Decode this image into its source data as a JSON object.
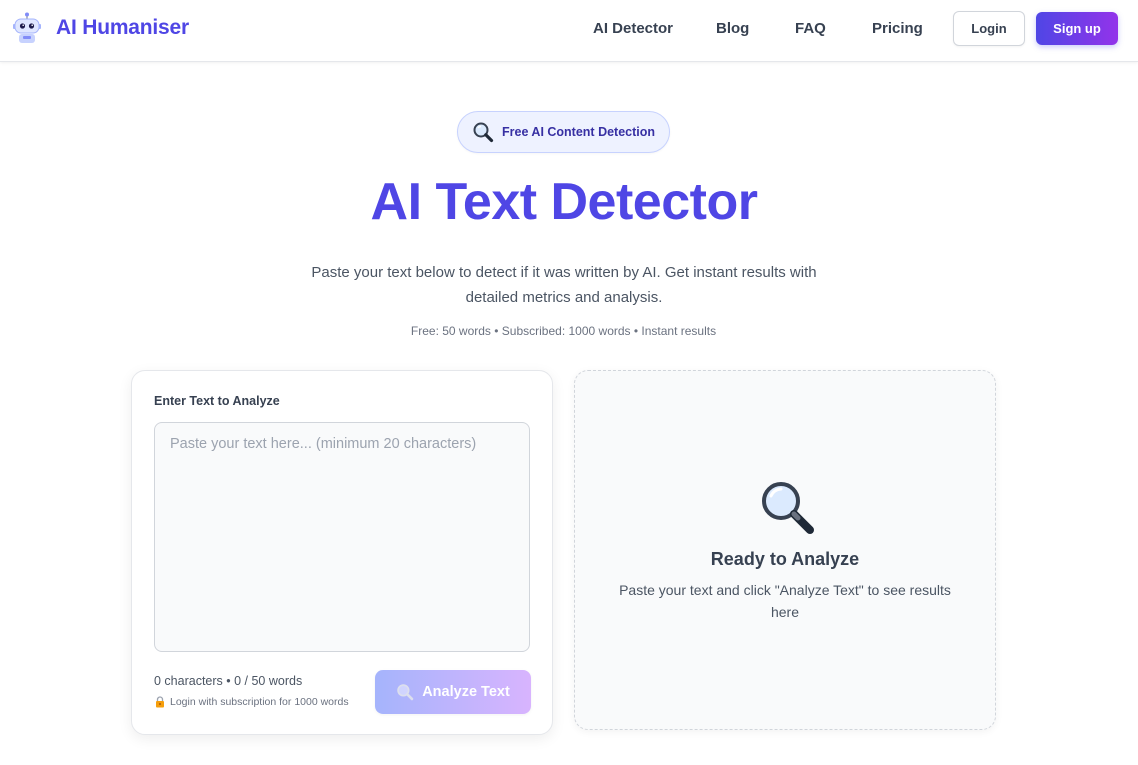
{
  "brand": {
    "name": "AI Humaniser",
    "logo_icon": "robot-icon"
  },
  "nav": {
    "links": [
      "AI Detector",
      "Blog",
      "FAQ",
      "Pricing"
    ],
    "login_label": "Login",
    "signup_label": "Sign up"
  },
  "hero": {
    "badge_icon": "magnifier-icon",
    "badge_text": "Free AI Content Detection",
    "title": "AI Text Detector",
    "subtitle": "Paste your text below to detect if it was written by AI. Get instant results with detailed metrics and analysis.",
    "meta": "Free: 50 words • Subscribed: 1000 words • Instant results"
  },
  "input_card": {
    "label": "Enter Text to Analyze",
    "value": "",
    "placeholder": "Paste your text here... (minimum 20 characters)",
    "counter": "0 characters • 0 / 50 words",
    "login_note": "Login with subscription for 1000 words",
    "analyze_label": "Analyze Text"
  },
  "result_card": {
    "icon": "magnifier-icon",
    "title": "Ready to Analyze",
    "subtitle": "Paste your text and click \"Analyze Text\" to see results here"
  },
  "colors": {
    "accent": "#4f46e5",
    "accent_end": "#9333ea",
    "badge_bg": "#eef2ff",
    "badge_text": "#3730a3"
  }
}
